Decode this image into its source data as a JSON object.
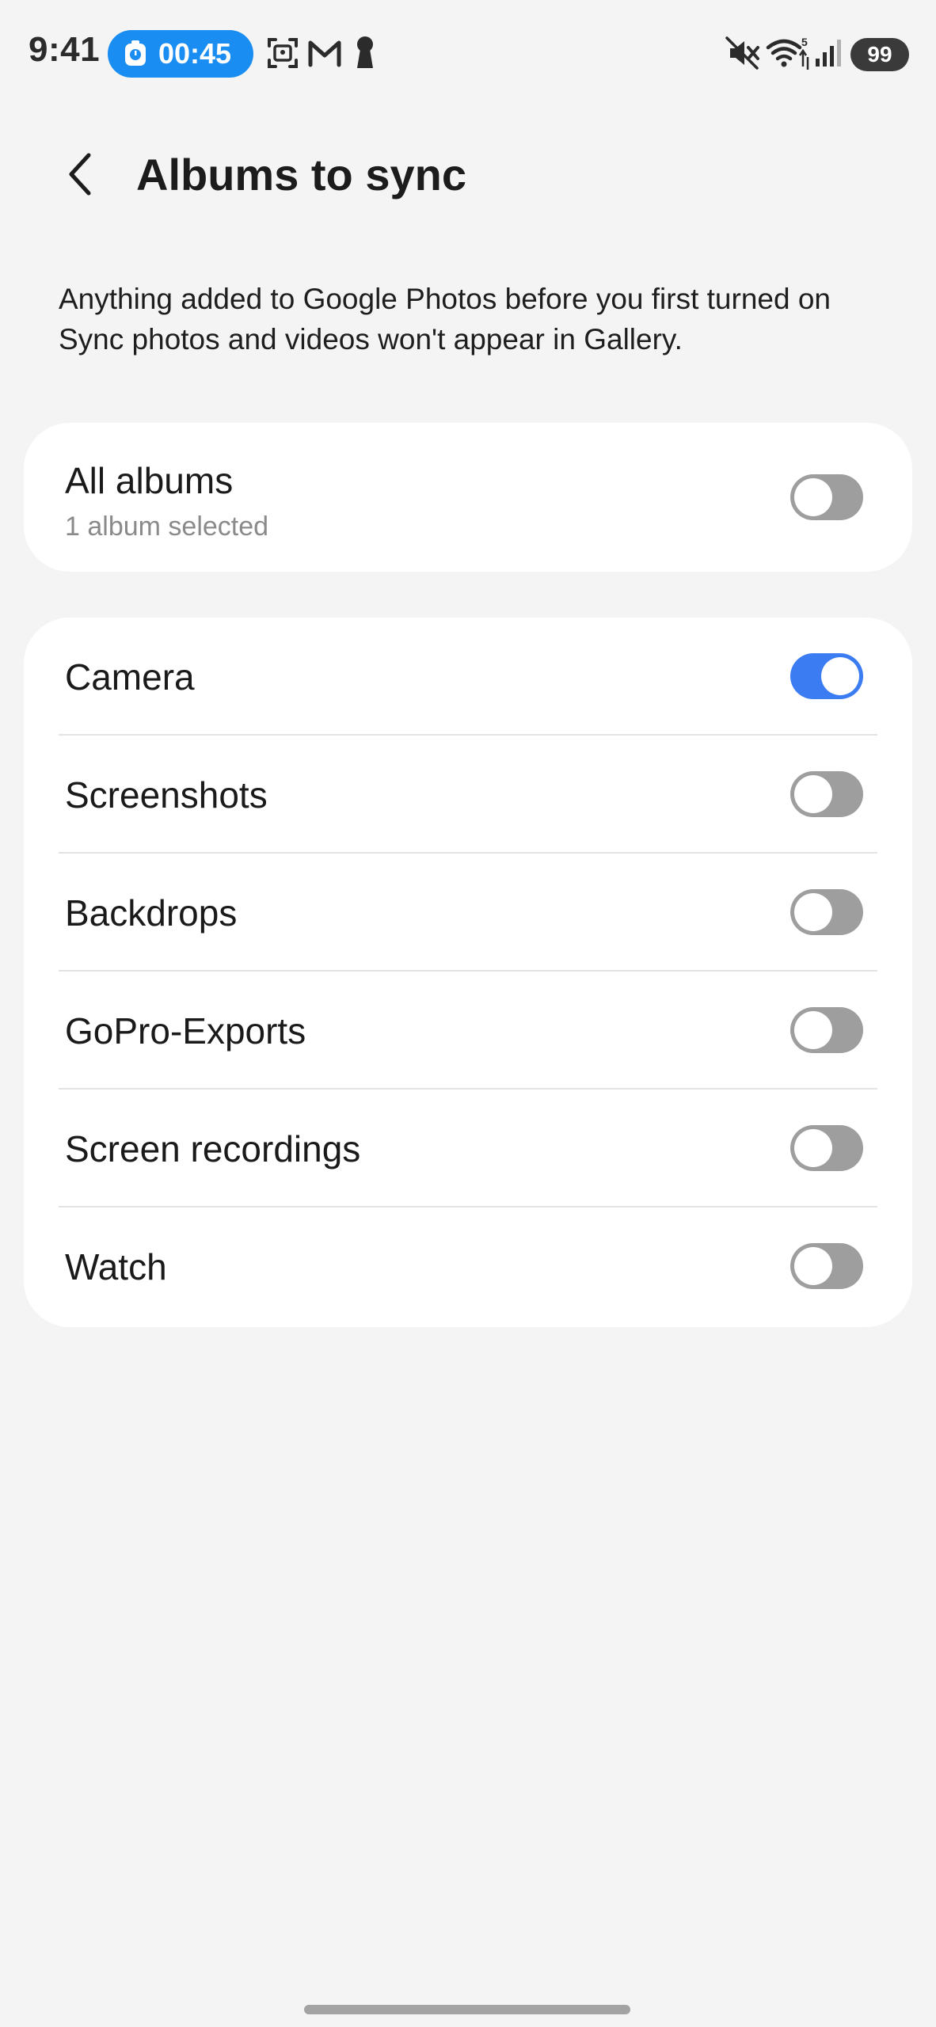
{
  "status_bar": {
    "time": "9:41",
    "timer": "00:45",
    "battery": "99",
    "icons": {
      "timer": "stopwatch-icon",
      "screenshot": "screenshot-icon",
      "gmail": "gmail-icon",
      "keyhole": "keyhole-icon",
      "mute": "mute-icon",
      "wifi": "wifi-icon",
      "signal": "signal-icon"
    },
    "colors": {
      "timer_pill": "#1a8df2",
      "battery_pill": "#3a3a3a"
    }
  },
  "header": {
    "back_icon": "chevron-left-icon",
    "title": "Albums to sync"
  },
  "description": "Anything added to Google Photos before you first turned on Sync photos and videos won't appear in Gallery.",
  "all_albums": {
    "title": "All albums",
    "subtitle": "1 album selected",
    "enabled": false
  },
  "albums": [
    {
      "label": "Camera",
      "enabled": true
    },
    {
      "label": "Screenshots",
      "enabled": false
    },
    {
      "label": "Backdrops",
      "enabled": false
    },
    {
      "label": "GoPro-Exports",
      "enabled": false
    },
    {
      "label": "Screen recordings",
      "enabled": false
    },
    {
      "label": "Watch",
      "enabled": false
    }
  ],
  "colors": {
    "toggle_on": "#3b7cf2",
    "toggle_off": "#9e9e9e",
    "background": "#f4f4f4",
    "card": "#ffffff"
  }
}
